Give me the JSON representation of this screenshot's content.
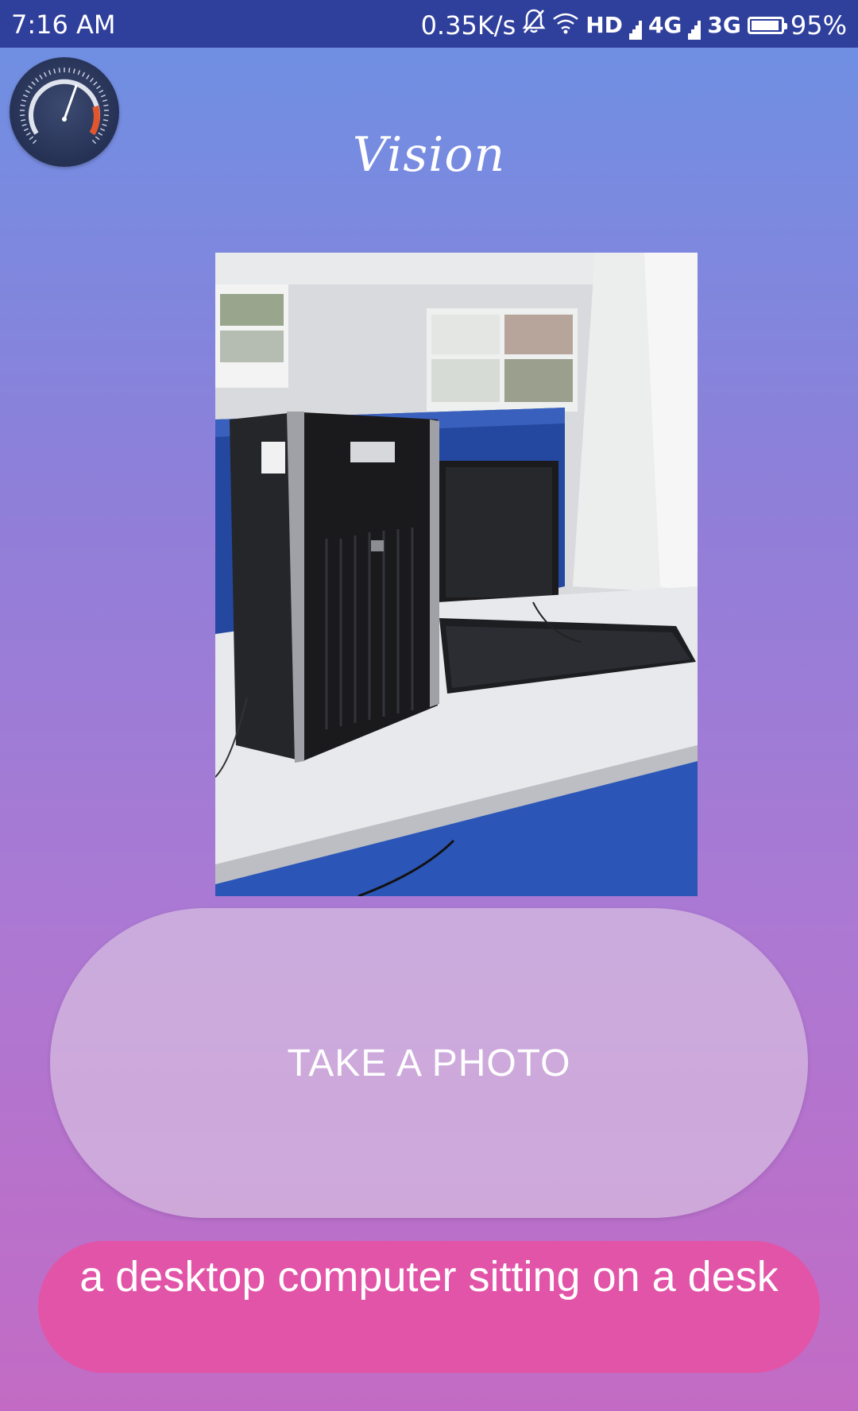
{
  "status_bar": {
    "time": "7:16 AM",
    "net_speed": "0.35K/s",
    "hd_label": "HD",
    "net1": "4G",
    "net2": "3G",
    "battery_text": "95%",
    "battery_level": 0.95,
    "icons": [
      "bell-off-icon",
      "wifi-icon",
      "signal-icon",
      "signal-icon",
      "battery-icon"
    ],
    "background_color": "#2f3f9c"
  },
  "header": {
    "logo_text": "Vision",
    "gauge_icon": "speedometer-icon"
  },
  "photo": {
    "subject": "desktop-computer-photo"
  },
  "actions": {
    "take_photo_label": "TAKE A PHOTO"
  },
  "result": {
    "caption": "a desktop computer sitting on a desk",
    "caption_background": "#e254a8"
  },
  "theme": {
    "gradient_top": "#6c91e3",
    "gradient_bottom": "#c36bc4"
  }
}
